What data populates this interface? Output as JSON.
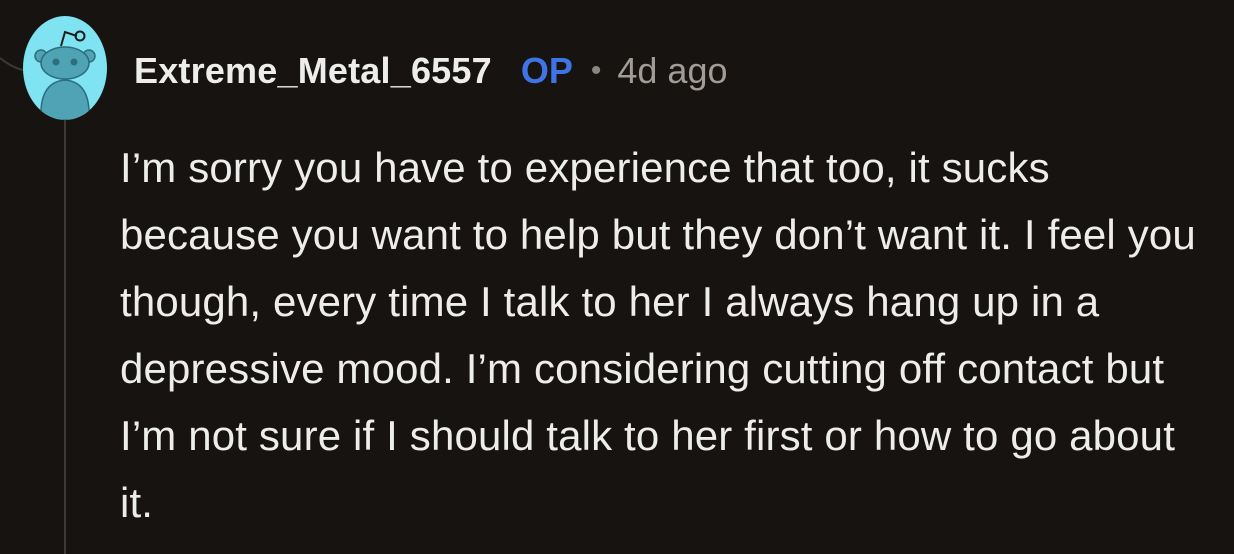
{
  "comment": {
    "author": "Extreme_Metal_6557",
    "op_badge": "OP",
    "separator": "•",
    "timestamp": "4d ago",
    "body": "I’m sorry you have to experience that too, it sucks because you want to help but they don’t want it. I feel you though, every time I talk to her I always hang up in a depressive mood. I’m considering cutting off contact but I’m not sure if I should talk to her first or how to go about it."
  },
  "colors": {
    "background": "#161311",
    "text": "#ededeb",
    "op_badge": "#3f74e6",
    "timestamp": "#a29c97",
    "thread_line": "#3d3935",
    "avatar_bg": "#7fe3f2",
    "avatar_figure": "#4fa3b5"
  },
  "icons": {
    "avatar": "snoo-avatar-icon"
  }
}
